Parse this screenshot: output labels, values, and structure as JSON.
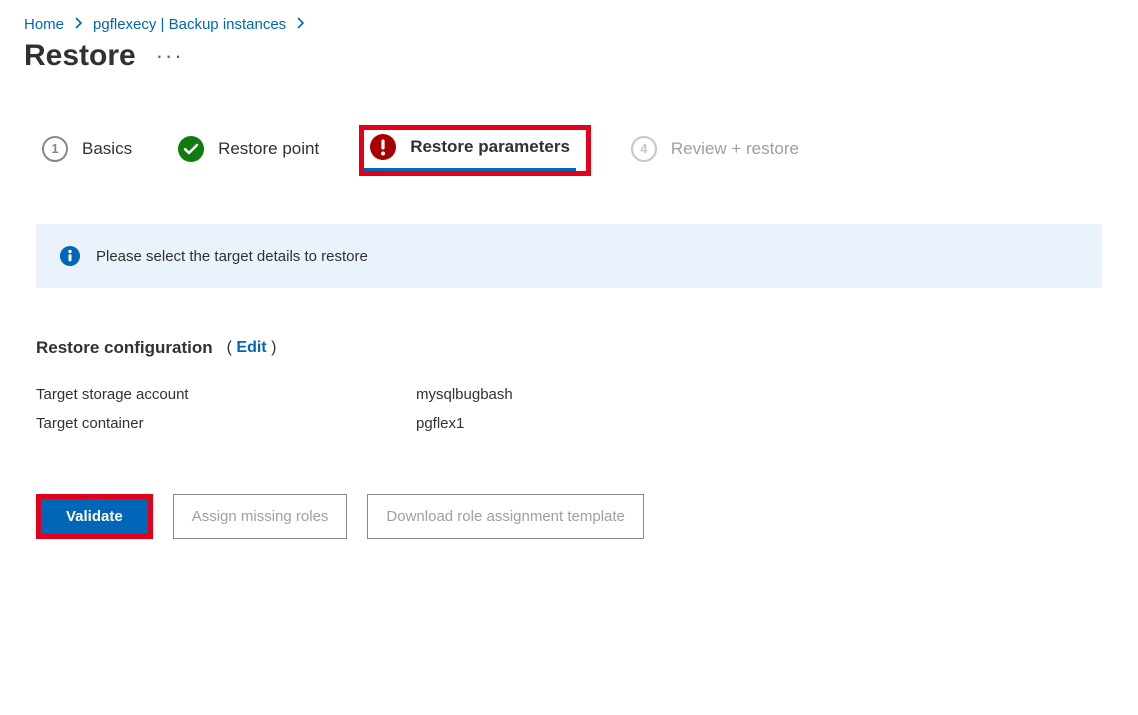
{
  "breadcrumb": {
    "home": "Home",
    "instance": "pgflexecy | Backup instances"
  },
  "page": {
    "title": "Restore"
  },
  "steps": {
    "basics": "Basics",
    "restore_point": "Restore point",
    "restore_params": "Restore parameters",
    "review": "Review + restore",
    "num1": "1",
    "num4": "4"
  },
  "infobar": {
    "text": "Please select the target details to restore"
  },
  "section": {
    "heading": "Restore configuration",
    "edit": "Edit"
  },
  "config": {
    "storage_account_label": "Target storage account",
    "storage_account_value": "mysqlbugbash",
    "container_label": "Target container",
    "container_value": "pgflex1"
  },
  "buttons": {
    "validate": "Validate",
    "assign_roles": "Assign missing roles",
    "download_template": "Download role assignment template"
  }
}
